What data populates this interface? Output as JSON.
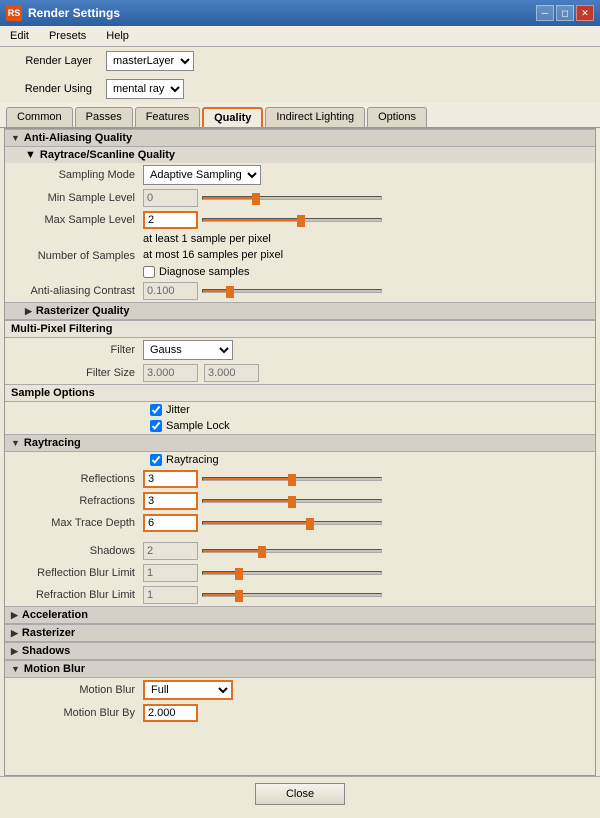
{
  "titleBar": {
    "title": "Render Settings",
    "icon": "RS",
    "controls": [
      "minimize",
      "restore",
      "close"
    ]
  },
  "menuBar": {
    "items": [
      "Edit",
      "Presets",
      "Help"
    ]
  },
  "renderLayer": {
    "label": "Render Layer",
    "value": "masterLayer"
  },
  "renderUsing": {
    "label": "Render Using",
    "value": "mental ray"
  },
  "tabs": [
    {
      "label": "Common",
      "active": false
    },
    {
      "label": "Passes",
      "active": false
    },
    {
      "label": "Features",
      "active": false
    },
    {
      "label": "Quality",
      "active": true
    },
    {
      "label": "Indirect Lighting",
      "active": false
    },
    {
      "label": "Options",
      "active": false
    }
  ],
  "sections": {
    "antiAliasing": {
      "title": "Anti-Aliasing Quality",
      "collapsed": false,
      "subsections": {
        "raytrace": {
          "title": "Raytrace/Scanline Quality",
          "samplingModeLabel": "Sampling Mode",
          "samplingModeValue": "Adaptive Sampling",
          "minSampleLabel": "Min Sample Level",
          "minSampleValue": "0",
          "maxSampleLabel": "Max Sample Level",
          "maxSampleValue": "2",
          "numberOfSamplesLabel": "Number of Samples",
          "samplesInfo1": "at least 1 sample per pixel",
          "samplesInfo2": "at most 16 samples per pixel",
          "diagnoseSamplesLabel": "Diagnose samples",
          "antiAliasingContrastLabel": "Anti-aliasing Contrast",
          "antiAliasingContrastValue": "0.100"
        }
      }
    },
    "rasterizer": {
      "title": "Rasterizer Quality",
      "collapsed": true
    },
    "multiPixel": {
      "title": "Multi-Pixel Filtering",
      "filterLabel": "Filter",
      "filterValue": "Gauss",
      "filterSizeLabel": "Filter Size",
      "filterSizeValue1": "3.000",
      "filterSizeValue2": "3.000"
    },
    "sampleOptions": {
      "title": "Sample Options",
      "jitterLabel": "Jitter",
      "jitterChecked": true,
      "sampleLockLabel": "Sample Lock",
      "sampleLockChecked": true
    },
    "raytracing": {
      "title": "Raytracing",
      "collapsed": false,
      "raytracingLabel": "Raytracing",
      "raytracingChecked": true,
      "reflectionsLabel": "Reflections",
      "reflectionsValue": "3",
      "refractionsLabel": "Refractions",
      "refractionsValue": "3",
      "maxTraceDepthLabel": "Max Trace Depth",
      "maxTraceDepthValue": "6",
      "shadowsLabel": "Shadows",
      "shadowsValue": "2",
      "reflectionBlurLabel": "Reflection Blur Limit",
      "reflectionBlurValue": "1",
      "refractionBlurLabel": "Refraction Blur Limit",
      "refractionBlurValue": "1"
    },
    "acceleration": {
      "title": "Acceleration",
      "collapsed": true
    },
    "rasterizer2": {
      "title": "Rasterizer",
      "collapsed": true
    },
    "shadows": {
      "title": "Shadows",
      "collapsed": true
    },
    "motionBlur": {
      "title": "Motion Blur",
      "collapsed": false,
      "motionBlurLabel": "Motion Blur",
      "motionBlurValue": "Full",
      "motionBlurByLabel": "Motion Blur By",
      "motionBlurByValue": "2.000"
    }
  },
  "footer": {
    "closeLabel": "Close"
  }
}
